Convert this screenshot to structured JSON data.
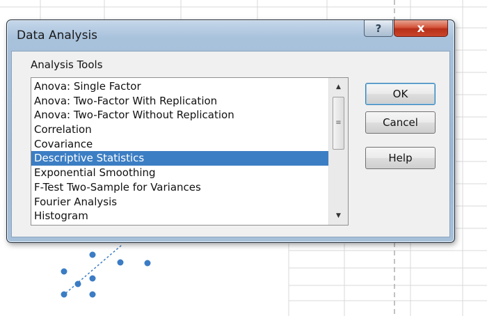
{
  "dialog": {
    "title": "Data Analysis",
    "help_button": "?",
    "close_button": "x"
  },
  "analysis_tools": {
    "label": "Analysis Tools",
    "items": [
      "Anova: Single Factor",
      "Anova: Two-Factor With Replication",
      "Anova: Two-Factor Without Replication",
      "Correlation",
      "Covariance",
      "Descriptive Statistics",
      "Exponential Smoothing",
      "F-Test Two-Sample for Variances",
      "Fourier Analysis",
      "Histogram"
    ],
    "selected": "Descriptive Statistics"
  },
  "buttons": {
    "ok": "OK",
    "cancel": "Cancel",
    "help": "Help"
  },
  "colors": {
    "selection": "#3c7ec4",
    "close_button": "#c9452a",
    "chart_points": "#3b7cc4"
  }
}
